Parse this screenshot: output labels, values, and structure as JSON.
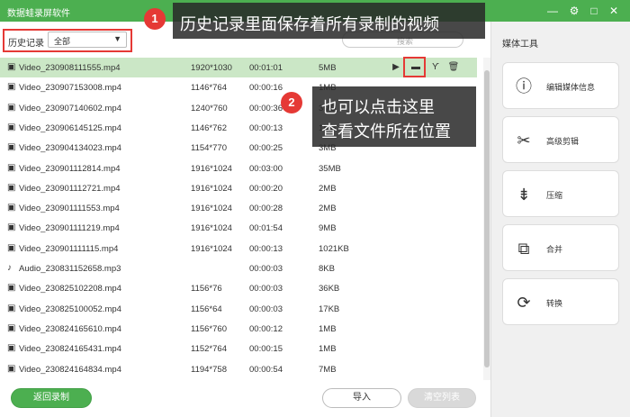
{
  "window": {
    "title": "数据蛙录屏软件",
    "controls": {
      "min": "—",
      "settings": "⚙",
      "max": "□",
      "close": "✕"
    }
  },
  "filter": {
    "label": "历史记录",
    "value": "全部"
  },
  "search": {
    "placeholder": "搜索"
  },
  "files": [
    {
      "type": "video",
      "name": "Video_230908111555.mp4",
      "resolution": "1920*1030",
      "duration": "00:01:01",
      "size": "5MB",
      "selected": true
    },
    {
      "type": "video",
      "name": "Video_230907153008.mp4",
      "resolution": "1146*764",
      "duration": "00:00:16",
      "size": "1MB"
    },
    {
      "type": "video",
      "name": "Video_230907140602.mp4",
      "resolution": "1240*760",
      "duration": "00:00:36",
      "size": "3MB"
    },
    {
      "type": "video",
      "name": "Video_230906145125.mp4",
      "resolution": "1146*762",
      "duration": "00:00:13",
      "size": "1MB"
    },
    {
      "type": "video",
      "name": "Video_230904134023.mp4",
      "resolution": "1154*770",
      "duration": "00:00:25",
      "size": "3MB"
    },
    {
      "type": "video",
      "name": "Video_230901112814.mp4",
      "resolution": "1916*1024",
      "duration": "00:03:00",
      "size": "35MB"
    },
    {
      "type": "video",
      "name": "Video_230901112721.mp4",
      "resolution": "1916*1024",
      "duration": "00:00:20",
      "size": "2MB"
    },
    {
      "type": "video",
      "name": "Video_230901111553.mp4",
      "resolution": "1916*1024",
      "duration": "00:00:28",
      "size": "2MB"
    },
    {
      "type": "video",
      "name": "Video_230901111219.mp4",
      "resolution": "1916*1024",
      "duration": "00:01:54",
      "size": "9MB"
    },
    {
      "type": "video",
      "name": "Video_230901111115.mp4",
      "resolution": "1916*1024",
      "duration": "00:00:13",
      "size": "1021KB"
    },
    {
      "type": "audio",
      "name": "Audio_230831152658.mp3",
      "resolution": "",
      "duration": "00:00:03",
      "size": "8KB"
    },
    {
      "type": "video",
      "name": "Video_230825102208.mp4",
      "resolution": "1156*76",
      "duration": "00:00:03",
      "size": "36KB"
    },
    {
      "type": "video",
      "name": "Video_230825100052.mp4",
      "resolution": "1156*64",
      "duration": "00:00:03",
      "size": "17KB"
    },
    {
      "type": "video",
      "name": "Video_230824165610.mp4",
      "resolution": "1156*760",
      "duration": "00:00:12",
      "size": "1MB"
    },
    {
      "type": "video",
      "name": "Video_230824165431.mp4",
      "resolution": "1152*764",
      "duration": "00:00:15",
      "size": "1MB"
    },
    {
      "type": "video",
      "name": "Video_230824164834.mp4",
      "resolution": "1194*758",
      "duration": "00:00:54",
      "size": "7MB"
    }
  ],
  "row_icons": {
    "video": "▣",
    "audio": "♪"
  },
  "row_actions": {
    "play": "▶",
    "folder": "▬",
    "wrench": "Ƴ",
    "trash": "🗑"
  },
  "buttons": {
    "back": "返回录制",
    "import": "导入",
    "clear": "清空列表"
  },
  "sidebar": {
    "title": "媒体工具",
    "tools": [
      {
        "label": "编辑媒体信息",
        "icon": "ⓘ"
      },
      {
        "label": "高级剪辑",
        "icon": "✂"
      },
      {
        "label": "压缩",
        "icon": "⇟"
      },
      {
        "label": "合并",
        "icon": "⧉"
      },
      {
        "label": "转换",
        "icon": "⟳"
      }
    ]
  },
  "annotations": {
    "badge1": "1",
    "callout1": "历史记录里面保存着所有录制的视频",
    "badge2": "2",
    "callout2_line1": "也可以点击这里",
    "callout2_line2": "查看文件所在位置"
  },
  "colors": {
    "brand": "#4caf50",
    "selected_row": "#cbe7c6",
    "highlight": "#e53935"
  }
}
